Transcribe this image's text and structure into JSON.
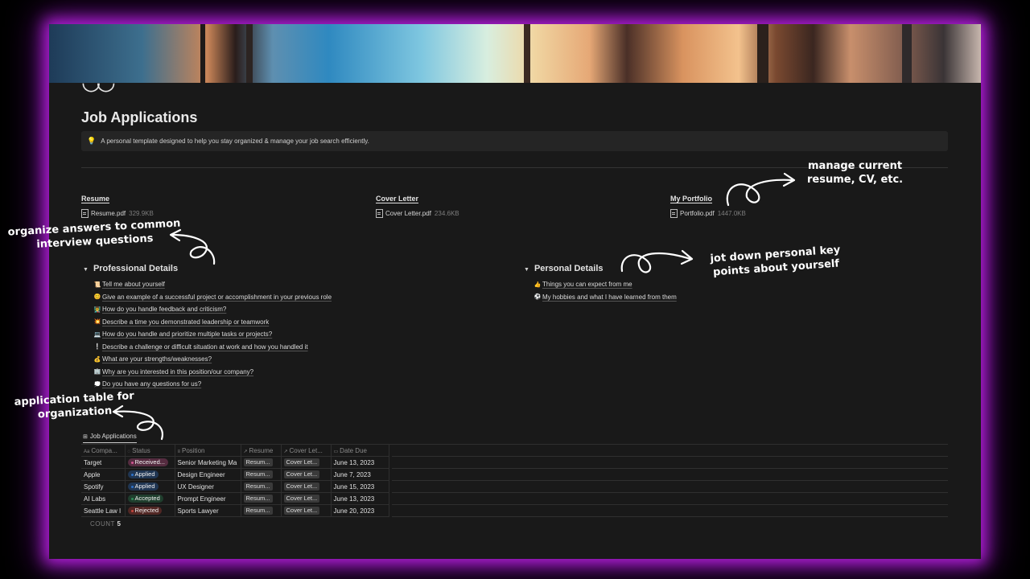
{
  "page": {
    "title": "Job Applications",
    "icon": "glasses-icon",
    "callout": {
      "icon": "lightbulb-icon",
      "text": "A personal template designed to help you stay organized & manage your job search efficiently."
    }
  },
  "files": [
    {
      "heading": "Resume",
      "name": "Resume.pdf",
      "size": "329.9KB"
    },
    {
      "heading": "Cover Letter",
      "name": "Cover Letter.pdf",
      "size": "234.6KB"
    },
    {
      "heading": "My Portfolio",
      "name": "Portfolio.pdf",
      "size": "1447.0KB"
    }
  ],
  "professional": {
    "heading": "Professional Details",
    "items": [
      {
        "emoji": "📜",
        "text": "Tell me about yourself"
      },
      {
        "emoji": "😊",
        "text": "Give an example of a successful project or accomplishment in your previous role"
      },
      {
        "emoji": "👨‍🏫",
        "text": "How do you handle feedback and criticism?"
      },
      {
        "emoji": "💥",
        "text": "Describe a time you demonstrated leadership or teamwork"
      },
      {
        "emoji": "💻",
        "text": "How do you handle and prioritize multiple tasks or projects?"
      },
      {
        "emoji": "❕",
        "text": "Describe a challenge or difficult situation at work and how you handled it"
      },
      {
        "emoji": "💰",
        "text": "What are your strengths/weaknesses?"
      },
      {
        "emoji": "🏢",
        "text": "Why are you interested in this position/our company?"
      },
      {
        "emoji": "💭",
        "text": "Do you have any questions for us?"
      }
    ]
  },
  "personal": {
    "heading": "Personal Details",
    "items": [
      {
        "emoji": "👍",
        "text": "Things you can expect from me"
      },
      {
        "emoji": "⚽",
        "text": "My hobbies and what I have learned from them"
      }
    ]
  },
  "database": {
    "tab_label": "Job Applications",
    "columns": [
      "Compa...",
      "Status",
      "Position",
      "Resume",
      "Cover Let...",
      "Date Due"
    ],
    "rows": [
      {
        "company": "Target",
        "status": "Received...",
        "status_color": "#d05591",
        "position": "Senior Marketing Ma",
        "resume": "Resum...",
        "cover": "Cover Let...",
        "date": "June 13, 2023"
      },
      {
        "company": "Apple",
        "status": "Applied",
        "status_color": "#2f72c9",
        "position": "Design Engineer",
        "resume": "Resum...",
        "cover": "Cover Let...",
        "date": "June 7, 2023"
      },
      {
        "company": "Spotify",
        "status": "Applied",
        "status_color": "#2f72c9",
        "position": "UX Designer",
        "resume": "Resum...",
        "cover": "Cover Let...",
        "date": "June 15, 2023"
      },
      {
        "company": "AI Labs",
        "status": "Accepted",
        "status_color": "#2e8a57",
        "position": "Prompt Engineer",
        "resume": "Resum...",
        "cover": "Cover Let...",
        "date": "June 13, 2023"
      },
      {
        "company": "Seattle Law I",
        "status": "Rejected",
        "status_color": "#c2463d",
        "position": "Sports Lawyer",
        "resume": "Resum...",
        "cover": "Cover Let...",
        "date": "June 20, 2023"
      }
    ],
    "count_label": "COUNT",
    "count_value": "5"
  },
  "annotations": {
    "manage": [
      "manage current",
      "resume, CV, etc."
    ],
    "organize": [
      "organize answers to common",
      "interview questions"
    ],
    "jot": [
      "jot down personal key",
      "points about yourself"
    ],
    "table": [
      "application table for",
      "organization"
    ]
  },
  "colors": {
    "frame_glow": "#b01fd6",
    "background": "#191919"
  }
}
